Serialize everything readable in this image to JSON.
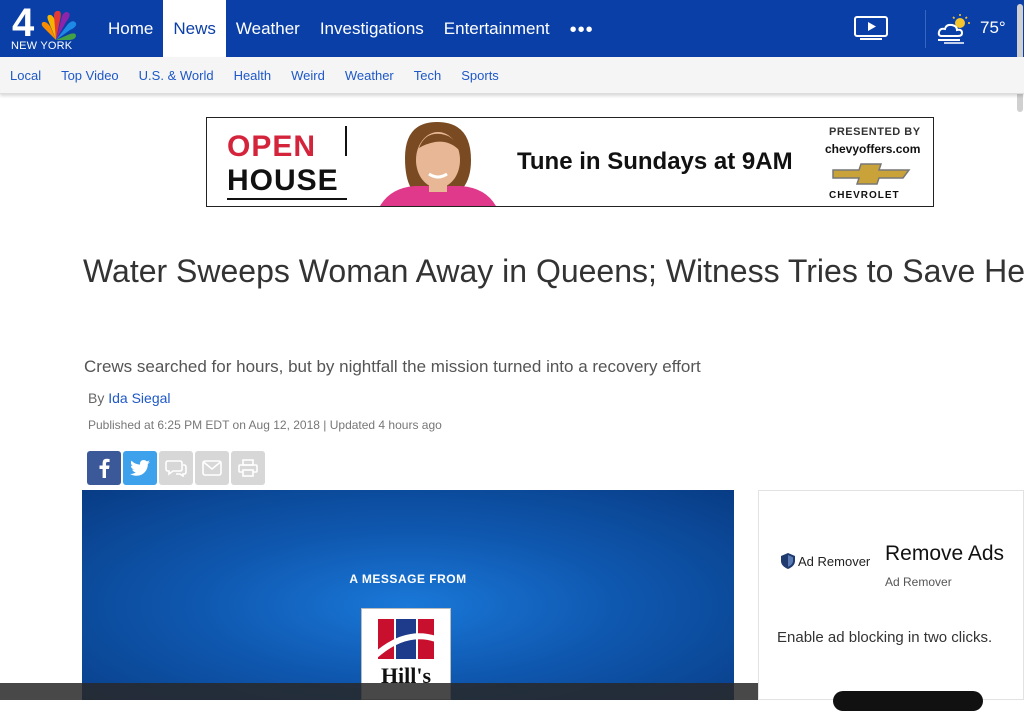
{
  "header": {
    "logo_number": "4",
    "logo_city": "NEW YORK",
    "nav": [
      {
        "label": "Home",
        "active": false
      },
      {
        "label": "News",
        "active": true
      },
      {
        "label": "Weather",
        "active": false
      },
      {
        "label": "Investigations",
        "active": false
      },
      {
        "label": "Entertainment",
        "active": false
      }
    ],
    "more_label": "•••",
    "temperature": "75°",
    "colors": {
      "brand": "#0b3fa8"
    }
  },
  "subnav": [
    "Local",
    "Top Video",
    "U.S. & World",
    "Health",
    "Weird",
    "Weather",
    "Tech",
    "Sports"
  ],
  "banner_ad": {
    "open": "OPEN",
    "house": "HOUSE",
    "tagline": "Tune in Sundays at 9AM",
    "presented_by": "PRESENTED BY",
    "site": "chevyoffers.com",
    "sponsor": "CHEVROLET"
  },
  "article": {
    "headline": "Water Sweeps Woman Away in Queens; Witness Tries to Save Her",
    "dek": "Crews searched for hours, but by nightfall the mission turned into a recovery effort",
    "by_prefix": "By",
    "author": "Ida Siegal",
    "published": "Published at 6:25 PM EDT on Aug 12, 2018 | Updated 4 hours ago"
  },
  "share_buttons": [
    "facebook-icon",
    "twitter-icon",
    "comment-icon",
    "email-icon",
    "print-icon"
  ],
  "video_ad": {
    "message": "A MESSAGE FROM",
    "brand": "Hill's"
  },
  "sidebar_ad": {
    "brand": "Ad Remover",
    "title": "Remove Ads",
    "subtitle": "Ad Remover",
    "description": "Enable ad blocking in two clicks."
  }
}
